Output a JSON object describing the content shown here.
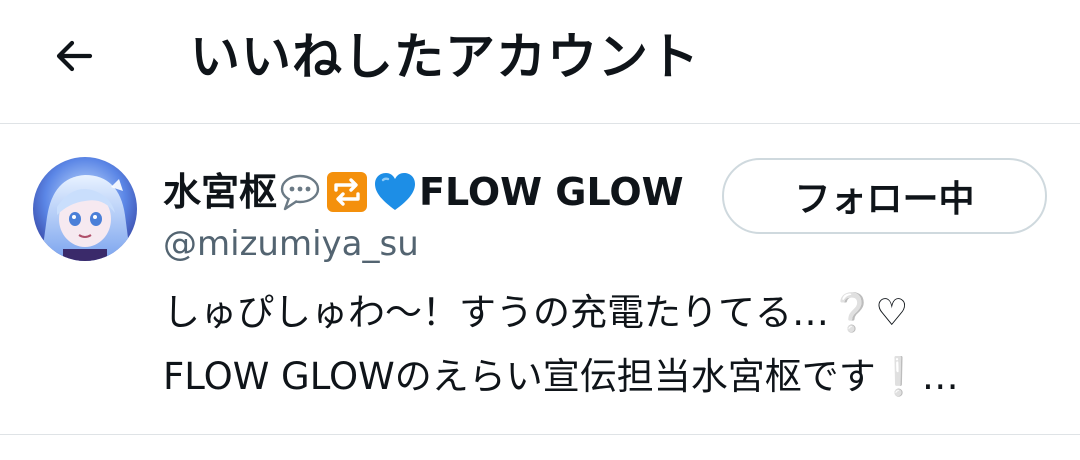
{
  "header": {
    "title": "いいねしたアカウント",
    "back_icon": "arrow-left-icon"
  },
  "user": {
    "display_name_prefix": "水宮枢",
    "display_name_suffix": "FLOW GLOW",
    "name_emojis": [
      "speech-balloon-icon",
      "repeat-icon",
      "blue-heart-icon"
    ],
    "username": "@mizumiya_su",
    "follow_label": "フォロー中",
    "bio_line1": "しゅぴしゅわ〜！すうの充電たりてる…❔♡",
    "bio_line2": "FLOW GLOWのえらい宣伝担当水宮枢です❕…"
  },
  "colors": {
    "text": "#0f1419",
    "secondary": "#536471",
    "border": "#cfd9de",
    "divider": "#dfe3e6",
    "repeat_bg": "#f4900c",
    "heart": "#1d8ee6"
  }
}
